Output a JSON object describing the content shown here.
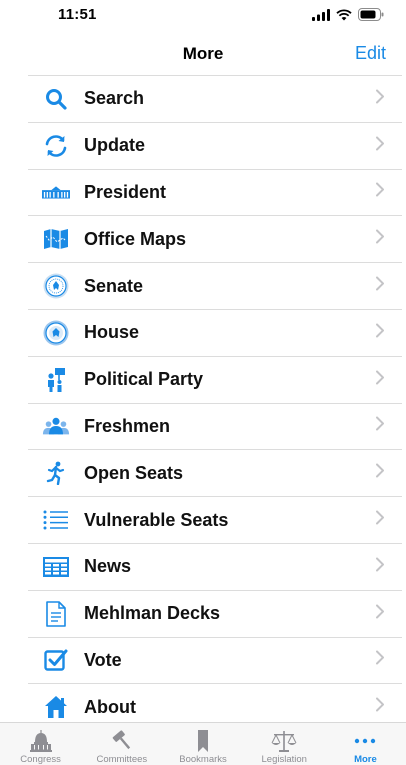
{
  "status": {
    "time": "11:51"
  },
  "nav": {
    "title": "More",
    "edit_label": "Edit"
  },
  "menu": [
    {
      "label": "Search",
      "icon": "search-icon"
    },
    {
      "label": "Update",
      "icon": "refresh-icon"
    },
    {
      "label": "President",
      "icon": "white-house-icon"
    },
    {
      "label": "Office Maps",
      "icon": "map-icon"
    },
    {
      "label": "Senate",
      "icon": "senate-seal-icon"
    },
    {
      "label": "House",
      "icon": "house-seal-icon"
    },
    {
      "label": "Political Party",
      "icon": "protest-sign-icon"
    },
    {
      "label": "Freshmen",
      "icon": "people-group-icon"
    },
    {
      "label": "Open Seats",
      "icon": "running-person-icon"
    },
    {
      "label": "Vulnerable Seats",
      "icon": "list-icon"
    },
    {
      "label": "News",
      "icon": "newspaper-icon"
    },
    {
      "label": "Mehlman Decks",
      "icon": "document-icon"
    },
    {
      "label": "Vote",
      "icon": "checkbox-icon"
    },
    {
      "label": "About",
      "icon": "home-icon"
    }
  ],
  "tabs": [
    {
      "label": "Congress",
      "icon": "capitol-icon"
    },
    {
      "label": "Committees",
      "icon": "gavel-icon"
    },
    {
      "label": "Bookmarks",
      "icon": "bookmark-icon"
    },
    {
      "label": "Legislation",
      "icon": "scales-icon"
    },
    {
      "label": "More",
      "icon": "more-dots-icon",
      "active": true
    }
  ],
  "colors": {
    "accent": "#1a8ae5",
    "separator": "#dcdcdc",
    "chevron": "#c4c4c7",
    "tab_inactive": "#8e8e93"
  }
}
